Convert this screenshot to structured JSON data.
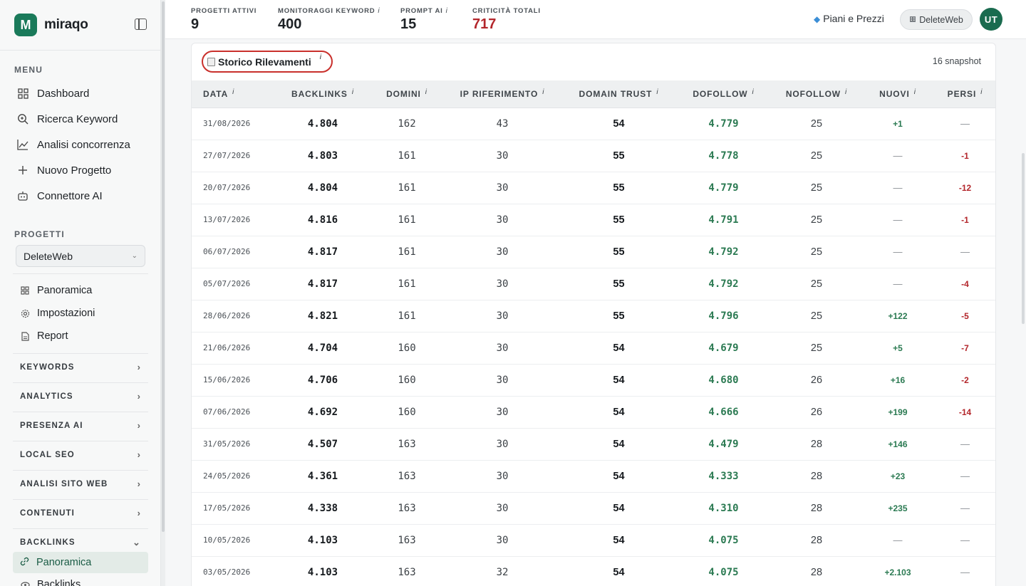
{
  "brand": {
    "name": "miraqo",
    "logo_letter": "M"
  },
  "sidebar": {
    "menu_label": "MENU",
    "menu": [
      {
        "label": "Dashboard",
        "icon": "grid-icon"
      },
      {
        "label": "Ricerca Keyword",
        "icon": "search-icon"
      },
      {
        "label": "Analisi concorrenza",
        "icon": "chart-line-icon"
      },
      {
        "label": "Nuovo Progetto",
        "icon": "plus-icon"
      },
      {
        "label": "Connettore AI",
        "icon": "robot-icon"
      }
    ],
    "projects_label": "PROGETTI",
    "project_selected": "DeleteWeb",
    "project_items": [
      {
        "label": "Panoramica",
        "icon": "grid-icon"
      },
      {
        "label": "Impostazioni",
        "icon": "gear-icon"
      },
      {
        "label": "Report",
        "icon": "document-icon"
      }
    ],
    "groups": [
      "KEYWORDS",
      "ANALYTICS",
      "PRESENZA AI",
      "LOCAL SEO",
      "ANALISI SITO WEB",
      "CONTENUTI",
      "BACKLINKS"
    ],
    "active_item": "Panoramica",
    "next_item": "Backlinks"
  },
  "topbar": {
    "stats": [
      {
        "label": "PROGETTI ATTIVI",
        "value": "9",
        "info": false
      },
      {
        "label": "MONITORAGGI KEYWORD",
        "value": "400",
        "info": true
      },
      {
        "label": "PROMPT AI",
        "value": "15",
        "info": true
      },
      {
        "label": "CRITICITÀ TOTALI",
        "value": "717",
        "info": false
      }
    ],
    "pricing": "Piani e Prezzi",
    "workspace": "DeleteWeb",
    "avatar": "UT"
  },
  "card": {
    "title": "Storico Rilevamenti",
    "snapshot": "16 snapshot",
    "columns": [
      "DATA",
      "BACKLINKS",
      "DOMINI",
      "IP RIFERIMENTO",
      "DOMAIN TRUST",
      "DOFOLLOW",
      "NOFOLLOW",
      "NUOVI",
      "PERSI"
    ],
    "rows": [
      [
        "31/08/2026",
        "4.804",
        "162",
        "43",
        "54",
        "4.779",
        "25",
        "+1",
        "—"
      ],
      [
        "27/07/2026",
        "4.803",
        "161",
        "30",
        "55",
        "4.778",
        "25",
        "—",
        "-1"
      ],
      [
        "20/07/2026",
        "4.804",
        "161",
        "30",
        "55",
        "4.779",
        "25",
        "—",
        "-12"
      ],
      [
        "13/07/2026",
        "4.816",
        "161",
        "30",
        "55",
        "4.791",
        "25",
        "—",
        "-1"
      ],
      [
        "06/07/2026",
        "4.817",
        "161",
        "30",
        "55",
        "4.792",
        "25",
        "—",
        "—"
      ],
      [
        "05/07/2026",
        "4.817",
        "161",
        "30",
        "55",
        "4.792",
        "25",
        "—",
        "-4"
      ],
      [
        "28/06/2026",
        "4.821",
        "161",
        "30",
        "55",
        "4.796",
        "25",
        "+122",
        "-5"
      ],
      [
        "21/06/2026",
        "4.704",
        "160",
        "30",
        "54",
        "4.679",
        "25",
        "+5",
        "-7"
      ],
      [
        "15/06/2026",
        "4.706",
        "160",
        "30",
        "54",
        "4.680",
        "26",
        "+16",
        "-2"
      ],
      [
        "07/06/2026",
        "4.692",
        "160",
        "30",
        "54",
        "4.666",
        "26",
        "+199",
        "-14"
      ],
      [
        "31/05/2026",
        "4.507",
        "163",
        "30",
        "54",
        "4.479",
        "28",
        "+146",
        "—"
      ],
      [
        "24/05/2026",
        "4.361",
        "163",
        "30",
        "54",
        "4.333",
        "28",
        "+23",
        "—"
      ],
      [
        "17/05/2026",
        "4.338",
        "163",
        "30",
        "54",
        "4.310",
        "28",
        "+235",
        "—"
      ],
      [
        "10/05/2026",
        "4.103",
        "163",
        "30",
        "54",
        "4.075",
        "28",
        "—",
        "—"
      ],
      [
        "03/05/2026",
        "4.103",
        "163",
        "32",
        "54",
        "4.075",
        "28",
        "+2.103",
        "—"
      ]
    ]
  },
  "colors": {
    "accent": "#1a7a5a",
    "positive": "#2b7a52",
    "negative": "#b3262b",
    "highlight_ring": "#c9302c"
  }
}
